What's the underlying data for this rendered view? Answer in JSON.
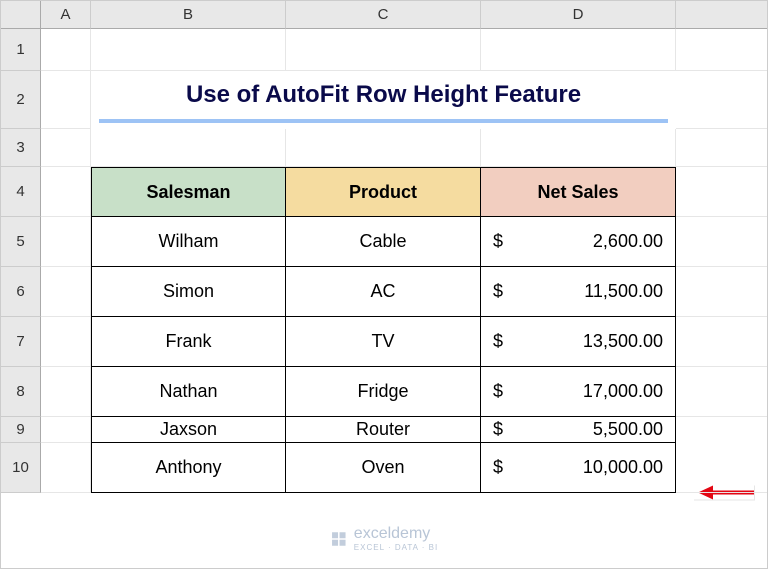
{
  "columns": [
    "A",
    "B",
    "C",
    "D"
  ],
  "rows": [
    "1",
    "2",
    "3",
    "4",
    "5",
    "6",
    "7",
    "8",
    "9",
    "10"
  ],
  "title": "Use of AutoFit Row Height Feature",
  "headers": {
    "salesman": "Salesman",
    "product": "Product",
    "netsales": "Net Sales"
  },
  "data": [
    {
      "salesman": "Wilham",
      "product": "Cable",
      "currency": "$",
      "value": "2,600.00"
    },
    {
      "salesman": "Simon",
      "product": "AC",
      "currency": "$",
      "value": "11,500.00"
    },
    {
      "salesman": "Frank",
      "product": "TV",
      "currency": "$",
      "value": "13,500.00"
    },
    {
      "salesman": "Nathan",
      "product": "Fridge",
      "currency": "$",
      "value": "17,000.00"
    },
    {
      "salesman": "Jaxson",
      "product": "Router",
      "currency": "$",
      "value": "5,500.00"
    },
    {
      "salesman": "Anthony",
      "product": "Oven",
      "currency": "$",
      "value": "10,000.00"
    }
  ],
  "watermark": {
    "brand": "exceldemy",
    "tag": "EXCEL · DATA · BI"
  },
  "chart_data": {
    "type": "table",
    "title": "Use of AutoFit Row Height Feature",
    "columns": [
      "Salesman",
      "Product",
      "Net Sales"
    ],
    "rows": [
      [
        "Wilham",
        "Cable",
        2600.0
      ],
      [
        "Simon",
        "AC",
        11500.0
      ],
      [
        "Frank",
        "TV",
        13500.0
      ],
      [
        "Nathan",
        "Fridge",
        17000.0
      ],
      [
        "Jaxson",
        "Router",
        5500.0
      ],
      [
        "Anthony",
        "Oven",
        10000.0
      ]
    ]
  }
}
